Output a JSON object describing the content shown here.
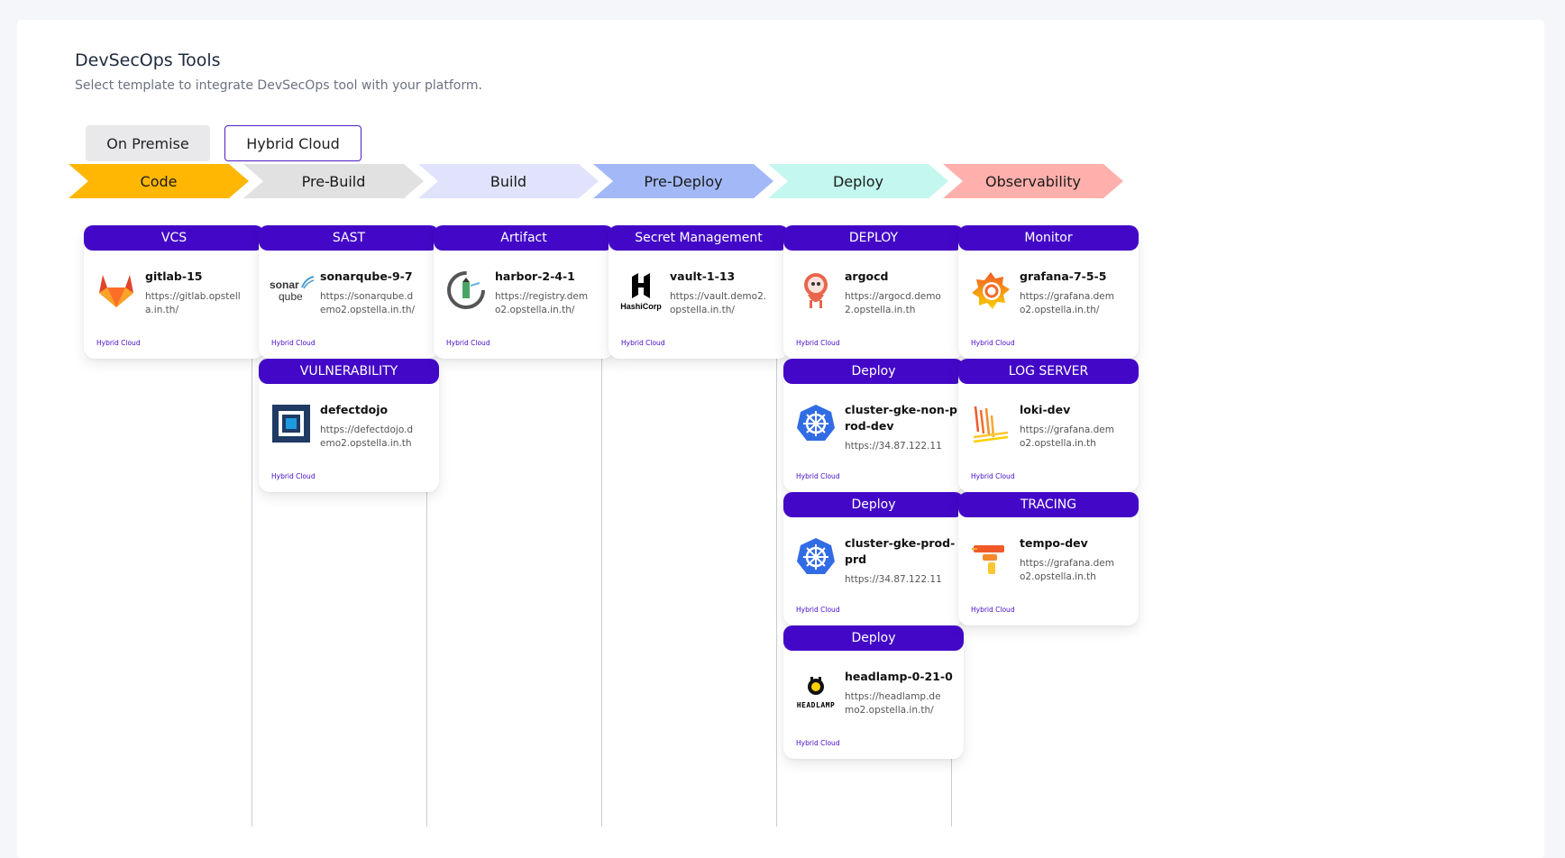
{
  "header": {
    "title": "DevSecOps Tools",
    "subtitle": "Select template to integrate DevSecOps tool with your platform."
  },
  "tabs": [
    {
      "label": "On Premise",
      "active": false
    },
    {
      "label": "Hybrid Cloud",
      "active": true
    }
  ],
  "stages": [
    {
      "label": "Code",
      "color": "#ffb703"
    },
    {
      "label": "Pre-Build",
      "color": "#e1e1e1"
    },
    {
      "label": "Build",
      "color": "#e0e3fb"
    },
    {
      "label": "Pre-Deploy",
      "color": "#a3b9f7"
    },
    {
      "label": "Deploy",
      "color": "#c3f7ef"
    },
    {
      "label": "Observability",
      "color": "#ffb0ac"
    }
  ],
  "columns": [
    {
      "cards": [
        {
          "category": "VCS",
          "name": "gitlab-15",
          "url": "https://gitlab.opstella.in.th/",
          "tag": "Hybrid Cloud",
          "icon": "gitlab-icon"
        }
      ]
    },
    {
      "cards": [
        {
          "category": "SAST",
          "name": "sonarqube-9-7",
          "url": "https://sonarqube.demo2.opstella.in.th/",
          "tag": "Hybrid Cloud",
          "icon": "sonarqube-icon",
          "logo_text": [
            "sonar",
            "qube"
          ]
        },
        {
          "category": "VULNERABILITY",
          "name": "defectdojo",
          "url": "https://defectdojo.demo2.opstella.in.th",
          "tag": "Hybrid Cloud",
          "icon": "defectdojo-icon"
        }
      ]
    },
    {
      "cards": [
        {
          "category": "Artifact",
          "name": "harbor-2-4-1",
          "url": "https://registry.demo2.opstella.in.th/",
          "tag": "Hybrid Cloud",
          "icon": "harbor-icon"
        }
      ]
    },
    {
      "cards": [
        {
          "category": "Secret Management",
          "name": "vault-1-13",
          "url": "https://vault.demo2.opstella.in.th/",
          "tag": "Hybrid Cloud",
          "icon": "hashicorp-icon",
          "logo_text": [
            "HashiCorp"
          ]
        }
      ]
    },
    {
      "cards": [
        {
          "category": "DEPLOY",
          "name": "argocd",
          "url": "https://argocd.demo2.opstella.in.th",
          "tag": "Hybrid Cloud",
          "icon": "argocd-icon"
        },
        {
          "category": "Deploy",
          "name": "cluster-gke-non-prod-dev",
          "url": "https://34.87.122.11",
          "tag": "Hybrid Cloud",
          "icon": "kubernetes-icon"
        },
        {
          "category": "Deploy",
          "name": "cluster-gke-prod-prd",
          "url": "https://34.87.122.11",
          "tag": "Hybrid Cloud",
          "icon": "kubernetes-icon"
        },
        {
          "category": "Deploy",
          "name": "headlamp-0-21-0",
          "url": "https://headlamp.demo2.opstella.in.th/",
          "tag": "Hybrid Cloud",
          "icon": "headlamp-icon",
          "logo_text": [
            "HEADLAMP"
          ]
        }
      ]
    },
    {
      "cards": [
        {
          "category": "Monitor",
          "name": "grafana-7-5-5",
          "url": "https://grafana.demo2.opstella.in.th/",
          "tag": "Hybrid Cloud",
          "icon": "grafana-icon"
        },
        {
          "category": "LOG SERVER",
          "name": "loki-dev",
          "url": "https://grafana.demo2.opstella.in.th",
          "tag": "Hybrid Cloud",
          "icon": "loki-icon"
        },
        {
          "category": "TRACING",
          "name": "tempo-dev",
          "url": "https://grafana.demo2.opstella.in.th",
          "tag": "Hybrid Cloud",
          "icon": "tempo-icon"
        }
      ]
    }
  ]
}
